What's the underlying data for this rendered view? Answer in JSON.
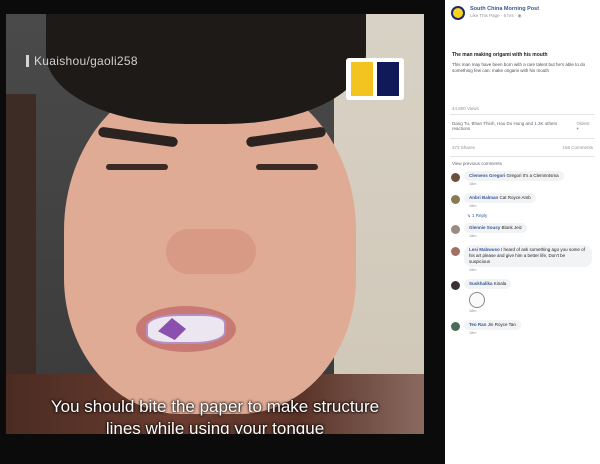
{
  "video": {
    "watermark": "Kuaishou/gaoli258",
    "caption_line1": "You should bite the paper to make structure",
    "caption_line2": "lines while using your tongue",
    "logo_colors": [
      "#f3c420",
      "#101a58"
    ]
  },
  "post": {
    "page_name": "South China Morning Post",
    "page_meta": "Like This Page · 6 hrs · ◉",
    "title": "The man making origami with his mouth",
    "body": "This man may have been born with a rare talent but he's able to do something few can: make origami with his mouth",
    "views": "44,800 Views"
  },
  "engagement": {
    "reactions_text": "Dang Tu, Bhan Thinh, Hau Do Hung and 1.3K others reactions",
    "oldest_label": "Oldest ▾",
    "shares": "373 Shares",
    "comments_count": "168 Comments",
    "view_previous": "View previous comments"
  },
  "comments": [
    {
      "name": "Clemens Gregori",
      "text": "Gregori It's a Clemnntsma",
      "meta": "18m"
    },
    {
      "name": "Anbri Balman",
      "text": "Cat Royce Amb",
      "meta": "18m"
    },
    {
      "name": "Glennie Sousy",
      "text": "Blank Jeiz",
      "meta": "18m"
    },
    {
      "name": "Lesi Mabwuso",
      "text": "I heard of ask something ago you some of his art please and give him a better life, Don't be suspicious",
      "meta": "18m"
    },
    {
      "name": "Suskhalika",
      "text": "Kinala",
      "meta": "18m"
    },
    {
      "name": "Teo Ran",
      "text": "Jin Royce Tan",
      "meta": "18m"
    }
  ],
  "reply_label": "↳ 1 Reply"
}
